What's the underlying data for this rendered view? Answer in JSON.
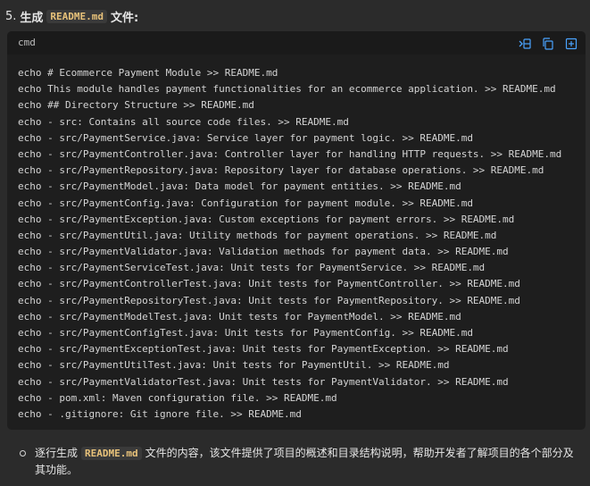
{
  "heading": {
    "number": "5.",
    "prefix": "生成",
    "filename": "README.md",
    "suffix": "文件:"
  },
  "codeblock": {
    "language": "cmd",
    "toolbar": {
      "icons": [
        "insert-into-terminal-icon",
        "copy-icon",
        "new-file-icon"
      ]
    },
    "lines": [
      "echo # Ecommerce Payment Module >> README.md",
      "echo This module handles payment functionalities for an ecommerce application. >> README.md",
      "echo ## Directory Structure >> README.md",
      "echo - src: Contains all source code files. >> README.md",
      "echo - src/PaymentService.java: Service layer for payment logic. >> README.md",
      "echo - src/PaymentController.java: Controller layer for handling HTTP requests. >> README.md",
      "echo - src/PaymentRepository.java: Repository layer for database operations. >> README.md",
      "echo - src/PaymentModel.java: Data model for payment entities. >> README.md",
      "echo - src/PaymentConfig.java: Configuration for payment module. >> README.md",
      "echo - src/PaymentException.java: Custom exceptions for payment errors. >> README.md",
      "echo - src/PaymentUtil.java: Utility methods for payment operations. >> README.md",
      "echo - src/PaymentValidator.java: Validation methods for payment data. >> README.md",
      "echo - src/PaymentServiceTest.java: Unit tests for PaymentService. >> README.md",
      "echo - src/PaymentControllerTest.java: Unit tests for PaymentController. >> README.md",
      "echo - src/PaymentRepositoryTest.java: Unit tests for PaymentRepository. >> README.md",
      "echo - src/PaymentModelTest.java: Unit tests for PaymentModel. >> README.md",
      "echo - src/PaymentConfigTest.java: Unit tests for PaymentConfig. >> README.md",
      "echo - src/PaymentExceptionTest.java: Unit tests for PaymentException. >> README.md",
      "echo - src/PaymentUtilTest.java: Unit tests for PaymentUtil. >> README.md",
      "echo - src/PaymentValidatorTest.java: Unit tests for PaymentValidator. >> README.md",
      "echo - pom.xml: Maven configuration file. >> README.md",
      "echo - .gitignore: Git ignore file. >> README.md"
    ]
  },
  "bullet": {
    "prefix": "逐行生成",
    "filename": "README.md",
    "suffix": "文件的内容，该文件提供了项目的概述和目录结构说明，帮助开发者了解项目的各个部分及其功能。"
  },
  "colors": {
    "background": "#2b2b2b",
    "code_background": "#1e1e1e",
    "toolbar_icon": "#4aa3ff",
    "inline_code": "#e8c27a"
  }
}
